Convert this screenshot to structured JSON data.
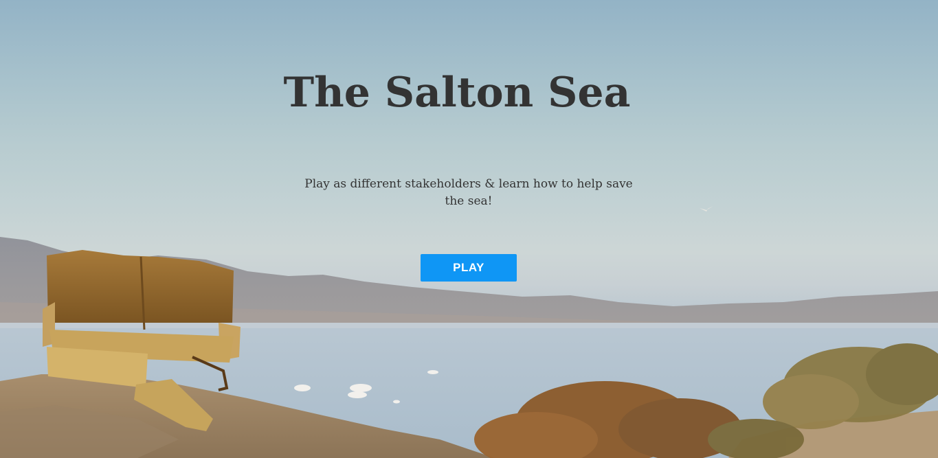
{
  "hero": {
    "title": "The Salton Sea",
    "subtitle": "Play as different stakeholders & learn how to help save the sea!",
    "play_label": "PLAY"
  },
  "colors": {
    "title_text": "#333333",
    "button_bg": "#0f96f5",
    "button_text": "#ffffff"
  }
}
